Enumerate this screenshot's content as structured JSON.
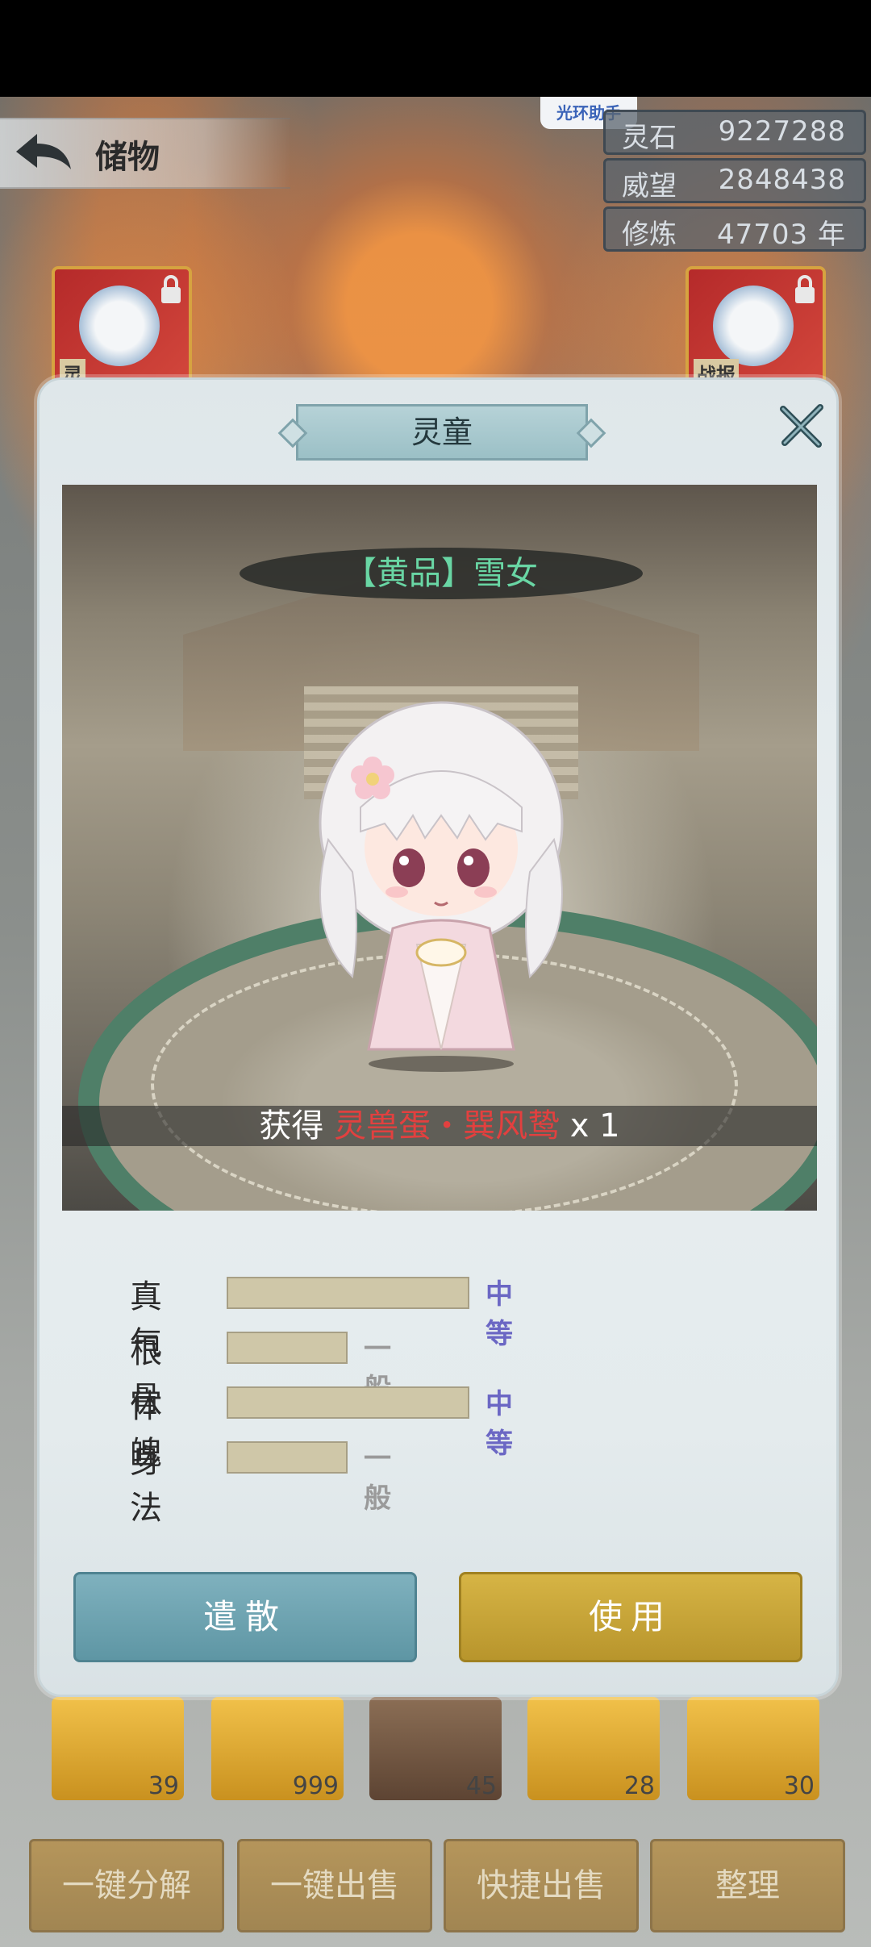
{
  "header": {
    "title": "储物",
    "helper_badge": "光环助手"
  },
  "resources": [
    {
      "label": "灵石",
      "value": "9227288"
    },
    {
      "label": "威望",
      "value": "2848438"
    },
    {
      "label": "修炼",
      "value": "47703 年"
    }
  ],
  "slots": {
    "left_tag": "灵",
    "right_tag": "战报"
  },
  "modal": {
    "title": "灵童",
    "character_name": "【黄品】雪女",
    "reward": {
      "prefix": "获得 ",
      "item": "灵兽蛋・巽风鸷",
      "suffix": " x 1"
    },
    "stats": [
      {
        "label": "真气",
        "grade": "中等",
        "level": 0.55,
        "grade_color": "#6b67c4"
      },
      {
        "label": "根骨",
        "grade": "一般",
        "level": 0.27,
        "grade_color": "#9a9a9a"
      },
      {
        "label": "体魄",
        "grade": "中等",
        "level": 0.55,
        "grade_color": "#6b67c4"
      },
      {
        "label": "身法",
        "grade": "一般",
        "level": 0.27,
        "grade_color": "#9a9a9a"
      }
    ],
    "buttons": {
      "dismiss": "遣散",
      "use": "使用"
    }
  },
  "chests": [
    {
      "count": "39",
      "type": "gold"
    },
    {
      "count": "999",
      "type": "gold"
    },
    {
      "count": "45",
      "type": "brown"
    },
    {
      "count": "28",
      "type": "gold"
    },
    {
      "count": "30",
      "type": "gold"
    }
  ],
  "bottom_actions": [
    "一键分解",
    "一键出售",
    "快捷出售",
    "整理"
  ]
}
